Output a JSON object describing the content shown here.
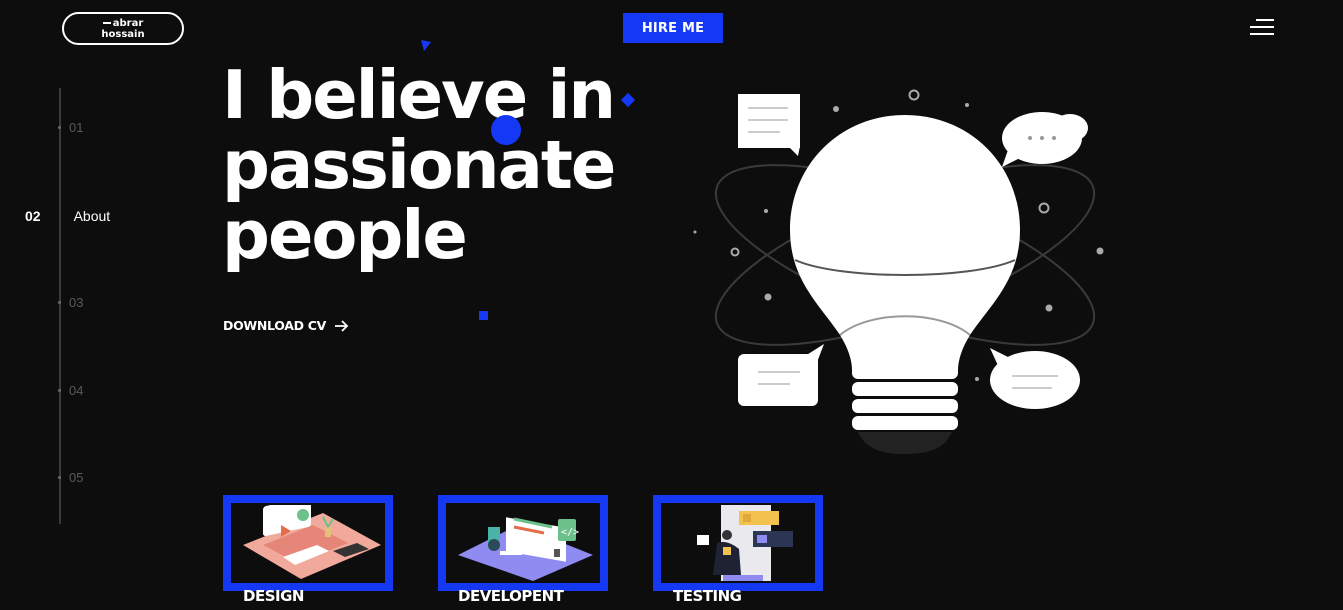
{
  "logo": {
    "line1": "abrar",
    "line2": "hossain"
  },
  "header": {
    "cta_label": "HIRE ME",
    "menu_icon": "hamburger-icon"
  },
  "sidebar": {
    "items": [
      {
        "num": "01",
        "label": ""
      },
      {
        "num": "02",
        "label": "About"
      },
      {
        "num": "03",
        "label": ""
      },
      {
        "num": "04",
        "label": ""
      },
      {
        "num": "05",
        "label": ""
      }
    ]
  },
  "hero": {
    "headline_line1": "I believe in",
    "headline_line2": "passionate",
    "headline_line3": "people",
    "download_label": "DOWNLOAD CV",
    "download_icon": "arrow-right-icon",
    "illustration_icon": "lightbulb-icon"
  },
  "services": [
    {
      "label": "DESIGN",
      "icon": "design-illustration-icon"
    },
    {
      "label": "DEVELOPENT",
      "icon": "development-illustration-icon"
    },
    {
      "label": "TESTING",
      "icon": "testing-illustration-icon"
    }
  ],
  "colors": {
    "accent": "#1538f5",
    "background": "#0d0d0e",
    "text": "#ffffff",
    "muted": "#5a5a5d"
  }
}
